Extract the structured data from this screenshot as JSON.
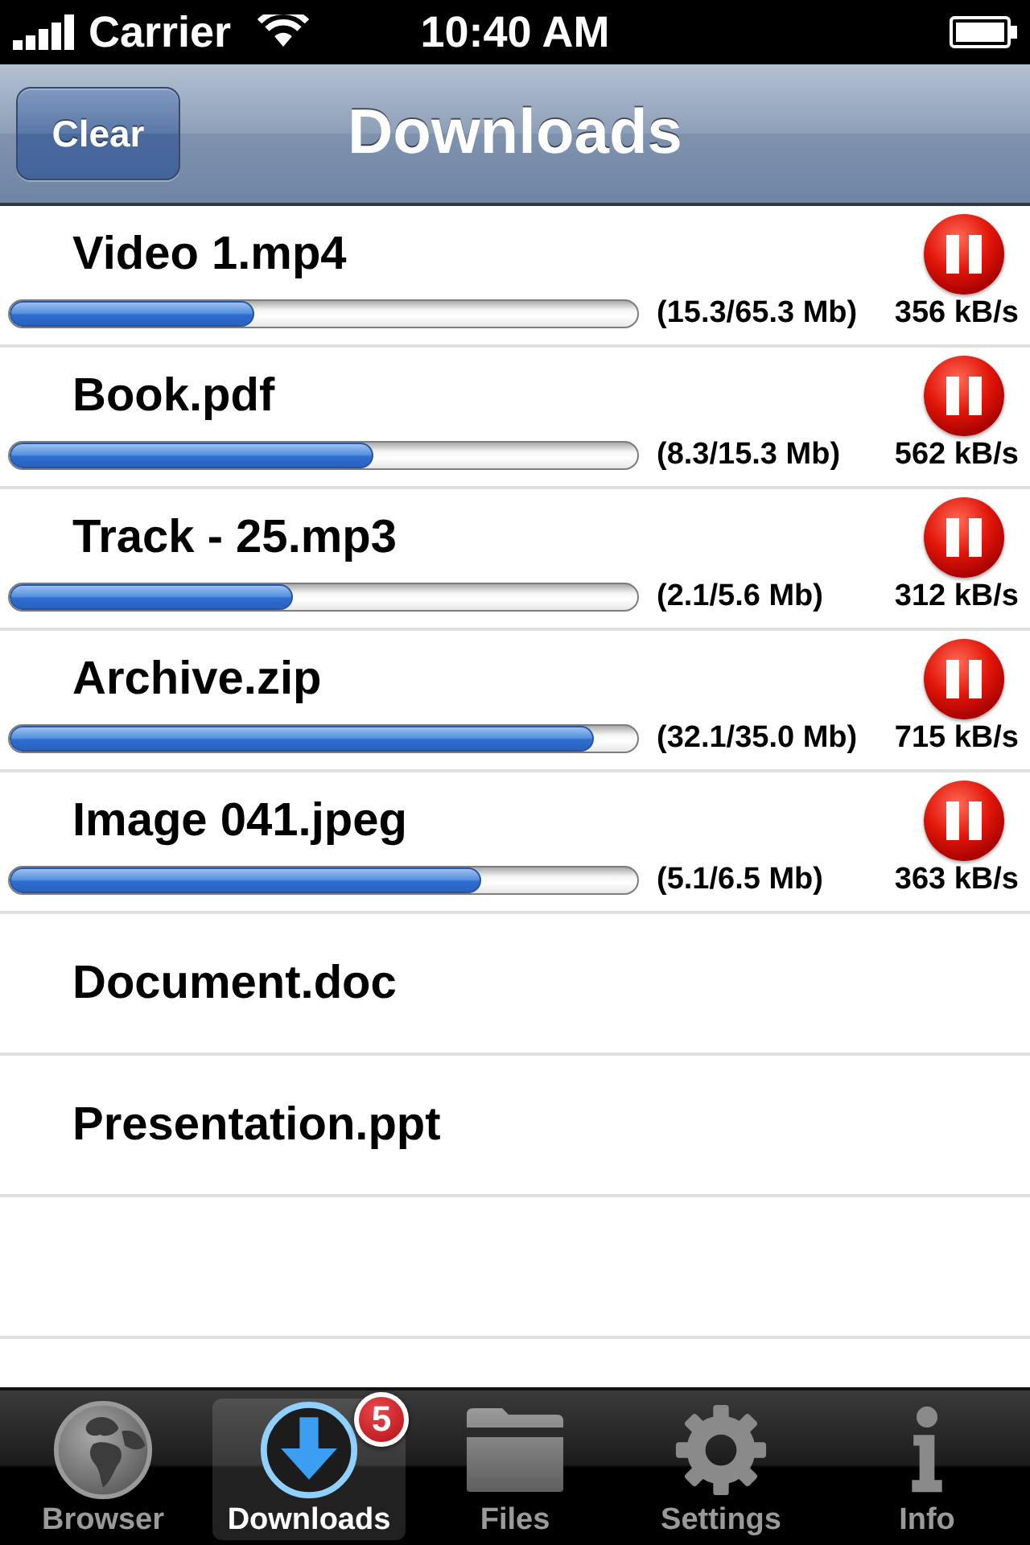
{
  "status_bar": {
    "carrier": "Carrier",
    "time": "10:40 AM"
  },
  "nav_bar": {
    "left_button": "Clear",
    "title": "Downloads"
  },
  "downloads": [
    {
      "kind": "active",
      "name": "Video 1.mp4",
      "level": 0.39,
      "size": "(15.3/65.3 Mb)",
      "speed": "356 kB/s"
    },
    {
      "kind": "active",
      "name": "Book.pdf",
      "level": 0.58,
      "size": "(8.3/15.3 Mb)",
      "speed": "562 kB/s"
    },
    {
      "kind": "active",
      "name": "Track - 25.mp3",
      "level": 0.45,
      "size": "(2.1/5.6 Mb)",
      "speed": "312 kB/s"
    },
    {
      "kind": "active",
      "name": "Archive.zip",
      "level": 0.93,
      "size": "(32.1/35.0 Mb)",
      "speed": "715 kB/s"
    },
    {
      "kind": "active",
      "name": "Image 041.jpeg",
      "level": 0.75,
      "size": "(5.1/6.5 Mb)",
      "speed": "363 kB/s"
    },
    {
      "kind": "plain",
      "name": "Document.doc"
    },
    {
      "kind": "plain",
      "name": "Presentation.ppt"
    }
  ],
  "tab_bar": [
    {
      "label": "Browser",
      "selected": false
    },
    {
      "label": "Downloads",
      "selected": true,
      "badge": "5"
    },
    {
      "label": "Files",
      "selected": false
    },
    {
      "label": "Settings",
      "selected": false
    },
    {
      "label": "Info",
      "selected": false
    }
  ]
}
